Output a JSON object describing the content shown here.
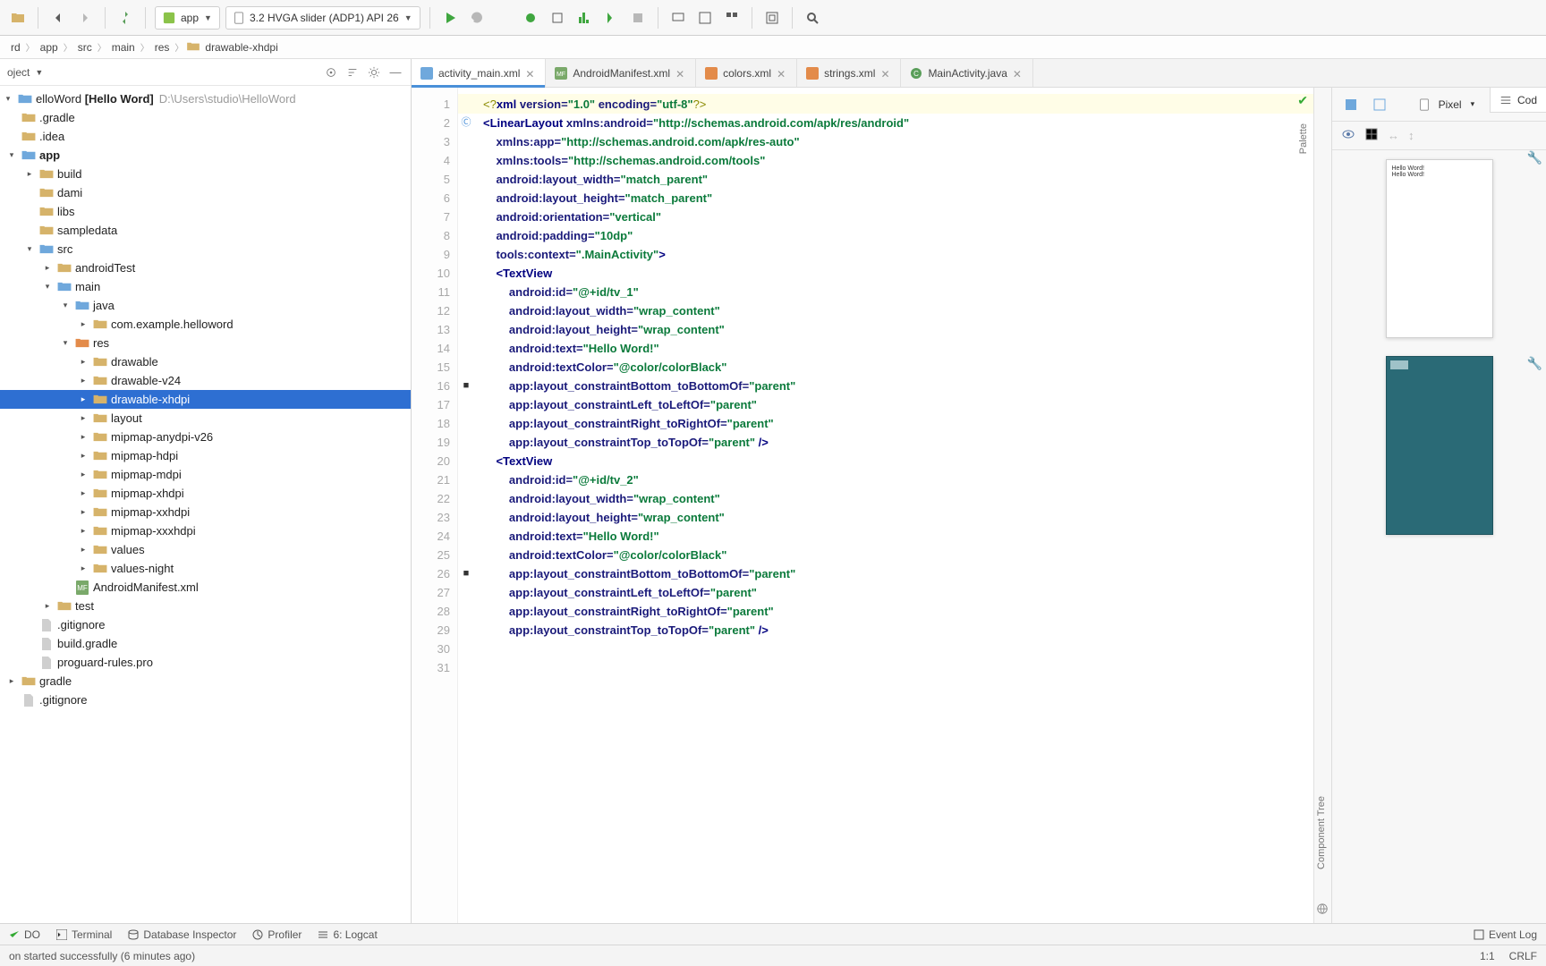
{
  "toolbar": {
    "module": "app",
    "device": "3.2  HVGA slider (ADP1) API 26"
  },
  "breadcrumbs": [
    "rd",
    "app",
    "src",
    "main",
    "res",
    "drawable-xhdpi"
  ],
  "projectHead": {
    "title": "oject"
  },
  "tree": {
    "root": {
      "name": "elloWord",
      "bold": "Hello Word",
      "path": "D:\\Users\\studio\\HelloWord"
    },
    "items": [
      {
        "d": 0,
        "exp": "",
        "icon": "folder",
        "name": ".gradle"
      },
      {
        "d": 0,
        "exp": "",
        "icon": "folder",
        "name": ".idea"
      },
      {
        "d": 0,
        "exp": "open",
        "icon": "folder-blue",
        "name": "app",
        "bold": true
      },
      {
        "d": 1,
        "exp": "closed",
        "icon": "folder",
        "name": "build"
      },
      {
        "d": 1,
        "exp": "",
        "icon": "folder",
        "name": "dami"
      },
      {
        "d": 1,
        "exp": "",
        "icon": "folder",
        "name": "libs"
      },
      {
        "d": 1,
        "exp": "",
        "icon": "folder",
        "name": "sampledata"
      },
      {
        "d": 1,
        "exp": "open",
        "icon": "folder-blue",
        "name": "src"
      },
      {
        "d": 2,
        "exp": "closed",
        "icon": "folder",
        "name": "androidTest"
      },
      {
        "d": 2,
        "exp": "open",
        "icon": "folder-blue",
        "name": "main"
      },
      {
        "d": 3,
        "exp": "open",
        "icon": "folder-blue",
        "name": "java"
      },
      {
        "d": 4,
        "exp": "closed",
        "icon": "folder",
        "name": "com.example.helloword"
      },
      {
        "d": 3,
        "exp": "open",
        "icon": "folder-orange",
        "name": "res"
      },
      {
        "d": 4,
        "exp": "closed",
        "icon": "folder",
        "name": "drawable"
      },
      {
        "d": 4,
        "exp": "closed",
        "icon": "folder",
        "name": "drawable-v24"
      },
      {
        "d": 4,
        "exp": "closed",
        "icon": "folder",
        "name": "drawable-xhdpi",
        "sel": true
      },
      {
        "d": 4,
        "exp": "closed",
        "icon": "folder",
        "name": "layout"
      },
      {
        "d": 4,
        "exp": "closed",
        "icon": "folder",
        "name": "mipmap-anydpi-v26"
      },
      {
        "d": 4,
        "exp": "closed",
        "icon": "folder",
        "name": "mipmap-hdpi"
      },
      {
        "d": 4,
        "exp": "closed",
        "icon": "folder",
        "name": "mipmap-mdpi"
      },
      {
        "d": 4,
        "exp": "closed",
        "icon": "folder",
        "name": "mipmap-xhdpi"
      },
      {
        "d": 4,
        "exp": "closed",
        "icon": "folder",
        "name": "mipmap-xxhdpi"
      },
      {
        "d": 4,
        "exp": "closed",
        "icon": "folder",
        "name": "mipmap-xxxhdpi"
      },
      {
        "d": 4,
        "exp": "closed",
        "icon": "folder",
        "name": "values"
      },
      {
        "d": 4,
        "exp": "closed",
        "icon": "folder",
        "name": "values-night"
      },
      {
        "d": 3,
        "exp": "",
        "icon": "file-mf",
        "name": "AndroidManifest.xml"
      },
      {
        "d": 2,
        "exp": "closed",
        "icon": "folder",
        "name": "test"
      },
      {
        "d": 1,
        "exp": "",
        "icon": "file",
        "name": ".gitignore"
      },
      {
        "d": 1,
        "exp": "",
        "icon": "file",
        "name": "build.gradle"
      },
      {
        "d": 1,
        "exp": "",
        "icon": "file",
        "name": "proguard-rules.pro"
      },
      {
        "d": 0,
        "exp": "closed",
        "icon": "folder",
        "name": "gradle"
      },
      {
        "d": 0,
        "exp": "",
        "icon": "file",
        "name": ".gitignore"
      }
    ]
  },
  "tabs": [
    {
      "label": "activity_main.xml",
      "icon": "xml-blue",
      "active": true
    },
    {
      "label": "AndroidManifest.xml",
      "icon": "mf"
    },
    {
      "label": "colors.xml",
      "icon": "xml-orange"
    },
    {
      "label": "strings.xml",
      "icon": "xml-orange"
    },
    {
      "label": "MainActivity.java",
      "icon": "java"
    }
  ],
  "codeView": {
    "button": "Cod"
  },
  "designBar": {
    "device": "Pixel",
    "zoom": "30",
    "paletteLabel": "Palette",
    "compTreeLabel": "Component Tree"
  },
  "preview": {
    "line1": "Hello Word!",
    "line2": "Hello Word!"
  },
  "code": [
    [
      {
        "c": "pi",
        "t": "<?"
      },
      {
        "c": "tag",
        "t": "xml "
      },
      {
        "c": "attr",
        "t": "version="
      },
      {
        "c": "str",
        "t": "\"1.0\" "
      },
      {
        "c": "attr",
        "t": "encoding="
      },
      {
        "c": "str",
        "t": "\"utf-8\""
      },
      {
        "c": "pi",
        "t": "?>"
      }
    ],
    [
      {
        "c": "tag",
        "t": "<LinearLayout "
      },
      {
        "c": "attr",
        "t": "xmlns:android="
      },
      {
        "c": "str",
        "t": "\"http://schemas.android.com/apk/res/android\""
      }
    ],
    [
      {
        "c": "",
        "t": "    "
      },
      {
        "c": "attr",
        "t": "xmlns:app="
      },
      {
        "c": "str",
        "t": "\"http://schemas.android.com/apk/res-auto\""
      }
    ],
    [
      {
        "c": "",
        "t": "    "
      },
      {
        "c": "attr",
        "t": "xmlns:tools="
      },
      {
        "c": "str",
        "t": "\"http://schemas.android.com/tools\""
      }
    ],
    [
      {
        "c": "",
        "t": "    "
      },
      {
        "c": "attr",
        "t": "android:layout_width="
      },
      {
        "c": "str",
        "t": "\"match_parent\""
      }
    ],
    [
      {
        "c": "",
        "t": "    "
      },
      {
        "c": "attr",
        "t": "android:layout_height="
      },
      {
        "c": "str",
        "t": "\"match_parent\""
      }
    ],
    [
      {
        "c": "",
        "t": "    "
      },
      {
        "c": "attr",
        "t": "android:orientation="
      },
      {
        "c": "str",
        "t": "\"vertical\""
      }
    ],
    [
      {
        "c": "",
        "t": "    "
      },
      {
        "c": "attr",
        "t": "android:padding="
      },
      {
        "c": "str",
        "t": "\"10dp\""
      }
    ],
    [
      {
        "c": "",
        "t": "    "
      },
      {
        "c": "attr",
        "t": "tools:context="
      },
      {
        "c": "str",
        "t": "\".MainActivity\""
      },
      {
        "c": "tag",
        "t": ">"
      }
    ],
    [
      {
        "c": "",
        "t": ""
      }
    ],
    [
      {
        "c": "",
        "t": "    "
      },
      {
        "c": "tag",
        "t": "<TextView"
      }
    ],
    [
      {
        "c": "",
        "t": "        "
      },
      {
        "c": "attr",
        "t": "android:id="
      },
      {
        "c": "str",
        "t": "\"@+id/tv_1\""
      }
    ],
    [
      {
        "c": "",
        "t": "        "
      },
      {
        "c": "attr",
        "t": "android:layout_width="
      },
      {
        "c": "str",
        "t": "\"wrap_content\""
      }
    ],
    [
      {
        "c": "",
        "t": "        "
      },
      {
        "c": "attr",
        "t": "android:layout_height="
      },
      {
        "c": "str",
        "t": "\"wrap_content\""
      }
    ],
    [
      {
        "c": "",
        "t": "        "
      },
      {
        "c": "attr",
        "t": "android:text="
      },
      {
        "c": "str",
        "t": "\"Hello Word!\""
      }
    ],
    [
      {
        "c": "",
        "t": "        "
      },
      {
        "c": "attr",
        "t": "android:textColor="
      },
      {
        "c": "str",
        "t": "\"@color/colorBlack\""
      }
    ],
    [
      {
        "c": "",
        "t": "        "
      },
      {
        "c": "attr",
        "t": "app:layout_constraintBottom_toBottomOf="
      },
      {
        "c": "str",
        "t": "\"parent\""
      }
    ],
    [
      {
        "c": "",
        "t": "        "
      },
      {
        "c": "attr",
        "t": "app:layout_constraintLeft_toLeftOf="
      },
      {
        "c": "str",
        "t": "\"parent\""
      }
    ],
    [
      {
        "c": "",
        "t": "        "
      },
      {
        "c": "attr",
        "t": "app:layout_constraintRight_toRightOf="
      },
      {
        "c": "str",
        "t": "\"parent\""
      }
    ],
    [
      {
        "c": "",
        "t": "        "
      },
      {
        "c": "attr",
        "t": "app:layout_constraintTop_toTopOf="
      },
      {
        "c": "str",
        "t": "\"parent\" "
      },
      {
        "c": "tag",
        "t": "/>"
      }
    ],
    [
      {
        "c": "",
        "t": "    "
      },
      {
        "c": "tag",
        "t": "<TextView"
      }
    ],
    [
      {
        "c": "",
        "t": "        "
      },
      {
        "c": "attr",
        "t": "android:id="
      },
      {
        "c": "str",
        "t": "\"@+id/tv_2\""
      }
    ],
    [
      {
        "c": "",
        "t": "        "
      },
      {
        "c": "attr",
        "t": "android:layout_width="
      },
      {
        "c": "str",
        "t": "\"wrap_content\""
      }
    ],
    [
      {
        "c": "",
        "t": "        "
      },
      {
        "c": "attr",
        "t": "android:layout_height="
      },
      {
        "c": "str",
        "t": "\"wrap_content\""
      }
    ],
    [
      {
        "c": "",
        "t": "        "
      },
      {
        "c": "attr",
        "t": "android:text="
      },
      {
        "c": "str",
        "t": "\"Hello Word!\""
      }
    ],
    [
      {
        "c": "",
        "t": "        "
      },
      {
        "c": "attr",
        "t": "android:textColor="
      },
      {
        "c": "str",
        "t": "\"@color/colorBlack\""
      }
    ],
    [
      {
        "c": "",
        "t": "        "
      },
      {
        "c": "attr",
        "t": "app:layout_constraintBottom_toBottomOf="
      },
      {
        "c": "str",
        "t": "\"parent\""
      }
    ],
    [
      {
        "c": "",
        "t": "        "
      },
      {
        "c": "attr",
        "t": "app:layout_constraintLeft_toLeftOf="
      },
      {
        "c": "str",
        "t": "\"parent\""
      }
    ],
    [
      {
        "c": "",
        "t": "        "
      },
      {
        "c": "attr",
        "t": "app:layout_constraintRight_toRightOf="
      },
      {
        "c": "str",
        "t": "\"parent\""
      }
    ],
    [
      {
        "c": "",
        "t": "        "
      },
      {
        "c": "attr",
        "t": "app:layout_constraintTop_toTopOf="
      },
      {
        "c": "str",
        "t": "\"parent\" "
      },
      {
        "c": "tag",
        "t": "/>"
      }
    ],
    [
      {
        "c": "",
        "t": ""
      }
    ]
  ],
  "bottomTools": {
    "todo": "DO",
    "terminal": "Terminal",
    "dbInspector": "Database Inspector",
    "profiler": "Profiler",
    "logcat": "6: Logcat",
    "eventLog": "Event Log"
  },
  "status": {
    "msg": "on started successfully (6 minutes ago)",
    "pos": "1:1",
    "eol": "CRLF"
  }
}
